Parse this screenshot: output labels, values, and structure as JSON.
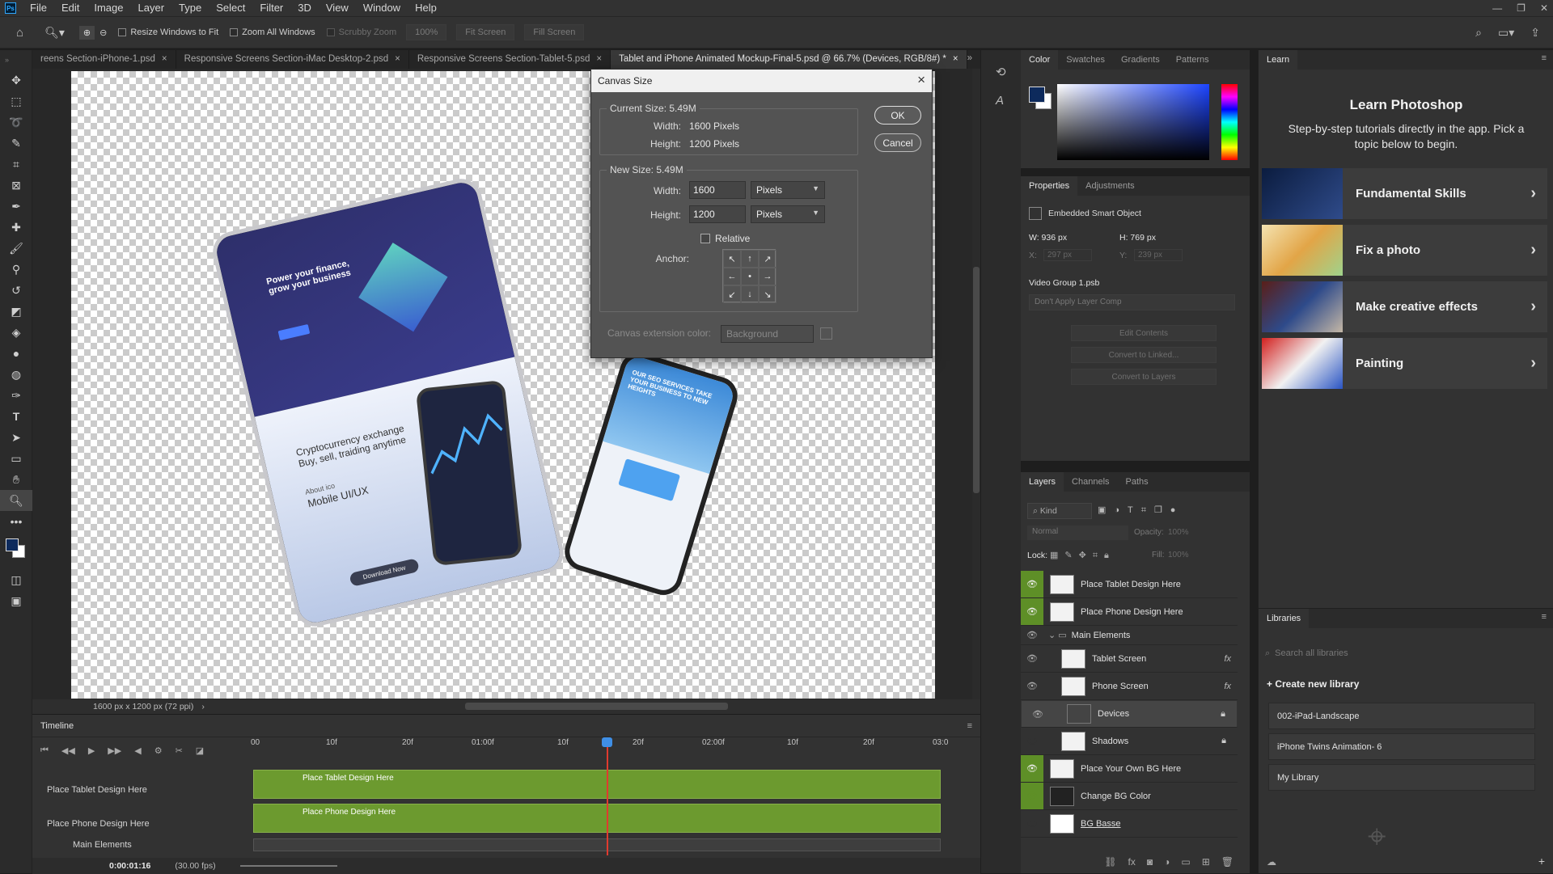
{
  "menubar": {
    "logo": "Ps",
    "items": [
      "File",
      "Edit",
      "Image",
      "Layer",
      "Type",
      "Select",
      "Filter",
      "3D",
      "View",
      "Window",
      "Help"
    ]
  },
  "optionsbar": {
    "resize_windows": "Resize Windows to Fit",
    "zoom_all": "Zoom All Windows",
    "scrubby": "Scrubby Zoom",
    "zoom_value": "100%",
    "fit_screen": "Fit Screen",
    "fill_screen": "Fill Screen"
  },
  "doc_tabs": [
    {
      "label": "reens Section-iPhone-1.psd",
      "close": "×"
    },
    {
      "label": "Responsive Screens Section-iMac Desktop-2.psd",
      "close": "×"
    },
    {
      "label": "Responsive Screens Section-Tablet-5.psd",
      "close": "×"
    },
    {
      "label": "Tablet and iPhone Animated Mockup-Final-5.psd @ 66.7% (Devices, RGB/8#) *",
      "close": "×"
    }
  ],
  "status": {
    "doc_size": "1600 px x 1200 px (72 ppi)",
    "arrow": "›"
  },
  "dialog": {
    "title": "Canvas Size",
    "close": "×",
    "current_size_label": "Current Size: 5.49M",
    "width_label": "Width:",
    "height_label": "Height:",
    "current_width": "1600 Pixels",
    "current_height": "1200 Pixels",
    "new_size_label": "New Size: 5.49M",
    "new_width": "1600",
    "new_height": "1200",
    "unit": "Pixels",
    "relative": "Relative",
    "anchor": "Anchor:",
    "anchor_arrows": [
      "↖",
      "↑",
      "↗",
      "←",
      "•",
      "→",
      "↙",
      "↓",
      "↘"
    ],
    "ext_color_label": "Canvas extension color:",
    "ext_color_value": "Background",
    "ok": "OK",
    "cancel": "Cancel"
  },
  "mockup": {
    "tablet_headline": "Power your finance, grow your business",
    "tablet_crypto": "Cryptocurrency exchange Buy, sell, traiding anytime",
    "tablet_about": "About ico",
    "tablet_mobile": "Mobile UI/UX",
    "tablet_cta": "Download Now",
    "phone_headline": "OUR SEO SERVICES TAKE YOUR BUSINESS TO NEW HEIGHTS"
  },
  "timeline": {
    "title": "Timeline",
    "ruler": [
      "00",
      "10f",
      "20f",
      "01:00f",
      "10f",
      "20f",
      "02:00f",
      "10f",
      "20f",
      "03:0"
    ],
    "tracks": [
      {
        "name": "Place Tablet Design Here",
        "clip": "Place Tablet Design Here"
      },
      {
        "name": "Place Phone Design Here",
        "clip": "Place Phone Design Here"
      }
    ],
    "group": "Main Elements",
    "timecode": "0:00:01:16",
    "fps": "(30.00 fps)"
  },
  "color_panel": {
    "tabs": [
      "Color",
      "Swatches",
      "Gradients",
      "Patterns"
    ],
    "foreground": "#0d2a5c",
    "background": "#ffffff"
  },
  "props_panel": {
    "tabs": [
      "Properties",
      "Adjustments"
    ],
    "type": "Embedded Smart Object",
    "w": "W:  936 px",
    "h": "H:  769 px",
    "x": "X:",
    "x_val": "297 px",
    "y": "Y:",
    "y_val": "239 px",
    "source": "Video Group 1.psb",
    "layer_comp": "Don't Apply Layer Comp",
    "edit_contents": "Edit Contents",
    "convert_linked": "Convert to Linked...",
    "convert_layers": "Convert to Layers"
  },
  "layers_panel": {
    "tabs": [
      "Layers",
      "Channels",
      "Paths"
    ],
    "kind": "Kind",
    "blend": "Normal",
    "opacity_label": "Opacity:",
    "opacity": "100%",
    "lock_label": "Lock:",
    "fill_label": "Fill:",
    "fill": "100%",
    "layers": [
      {
        "name": "Place Tablet Design Here",
        "visible": true,
        "indent": 0,
        "fx": false,
        "lock": false
      },
      {
        "name": "Place Phone Design Here",
        "visible": true,
        "indent": 0,
        "fx": false,
        "lock": false
      },
      {
        "name": "Main Elements",
        "visible": true,
        "indent": 0,
        "fx": false,
        "lock": false,
        "group": true
      },
      {
        "name": "Tablet Screen",
        "visible": true,
        "indent": 1,
        "fx": true,
        "lock": false
      },
      {
        "name": "Phone Screen",
        "visible": true,
        "indent": 1,
        "fx": true,
        "lock": false
      },
      {
        "name": "Devices",
        "visible": true,
        "indent": 1,
        "fx": false,
        "lock": true,
        "selected": true
      },
      {
        "name": "Shadows",
        "visible": false,
        "indent": 1,
        "fx": false,
        "lock": true
      },
      {
        "name": "Place Your Own BG Here",
        "visible": true,
        "indent": 0,
        "fx": false,
        "lock": false
      },
      {
        "name": "Change BG Color",
        "visible": false,
        "indent": 0,
        "fx": false,
        "lock": false
      },
      {
        "name": "BG Basse",
        "visible": false,
        "indent": 0,
        "fx": false,
        "lock": false
      }
    ]
  },
  "learn_panel": {
    "tab": "Learn",
    "title": "Learn Photoshop",
    "subtitle": "Step-by-step tutorials directly in the app. Pick a topic below to begin.",
    "cards": [
      "Fundamental Skills",
      "Fix a photo",
      "Make creative effects",
      "Painting"
    ]
  },
  "libraries_panel": {
    "tab": "Libraries",
    "search_placeholder": "Search all libraries",
    "create": "Create new library",
    "libraries": [
      "002-iPad-Landscape",
      "iPhone Twins Animation- 6",
      "My Library"
    ]
  }
}
